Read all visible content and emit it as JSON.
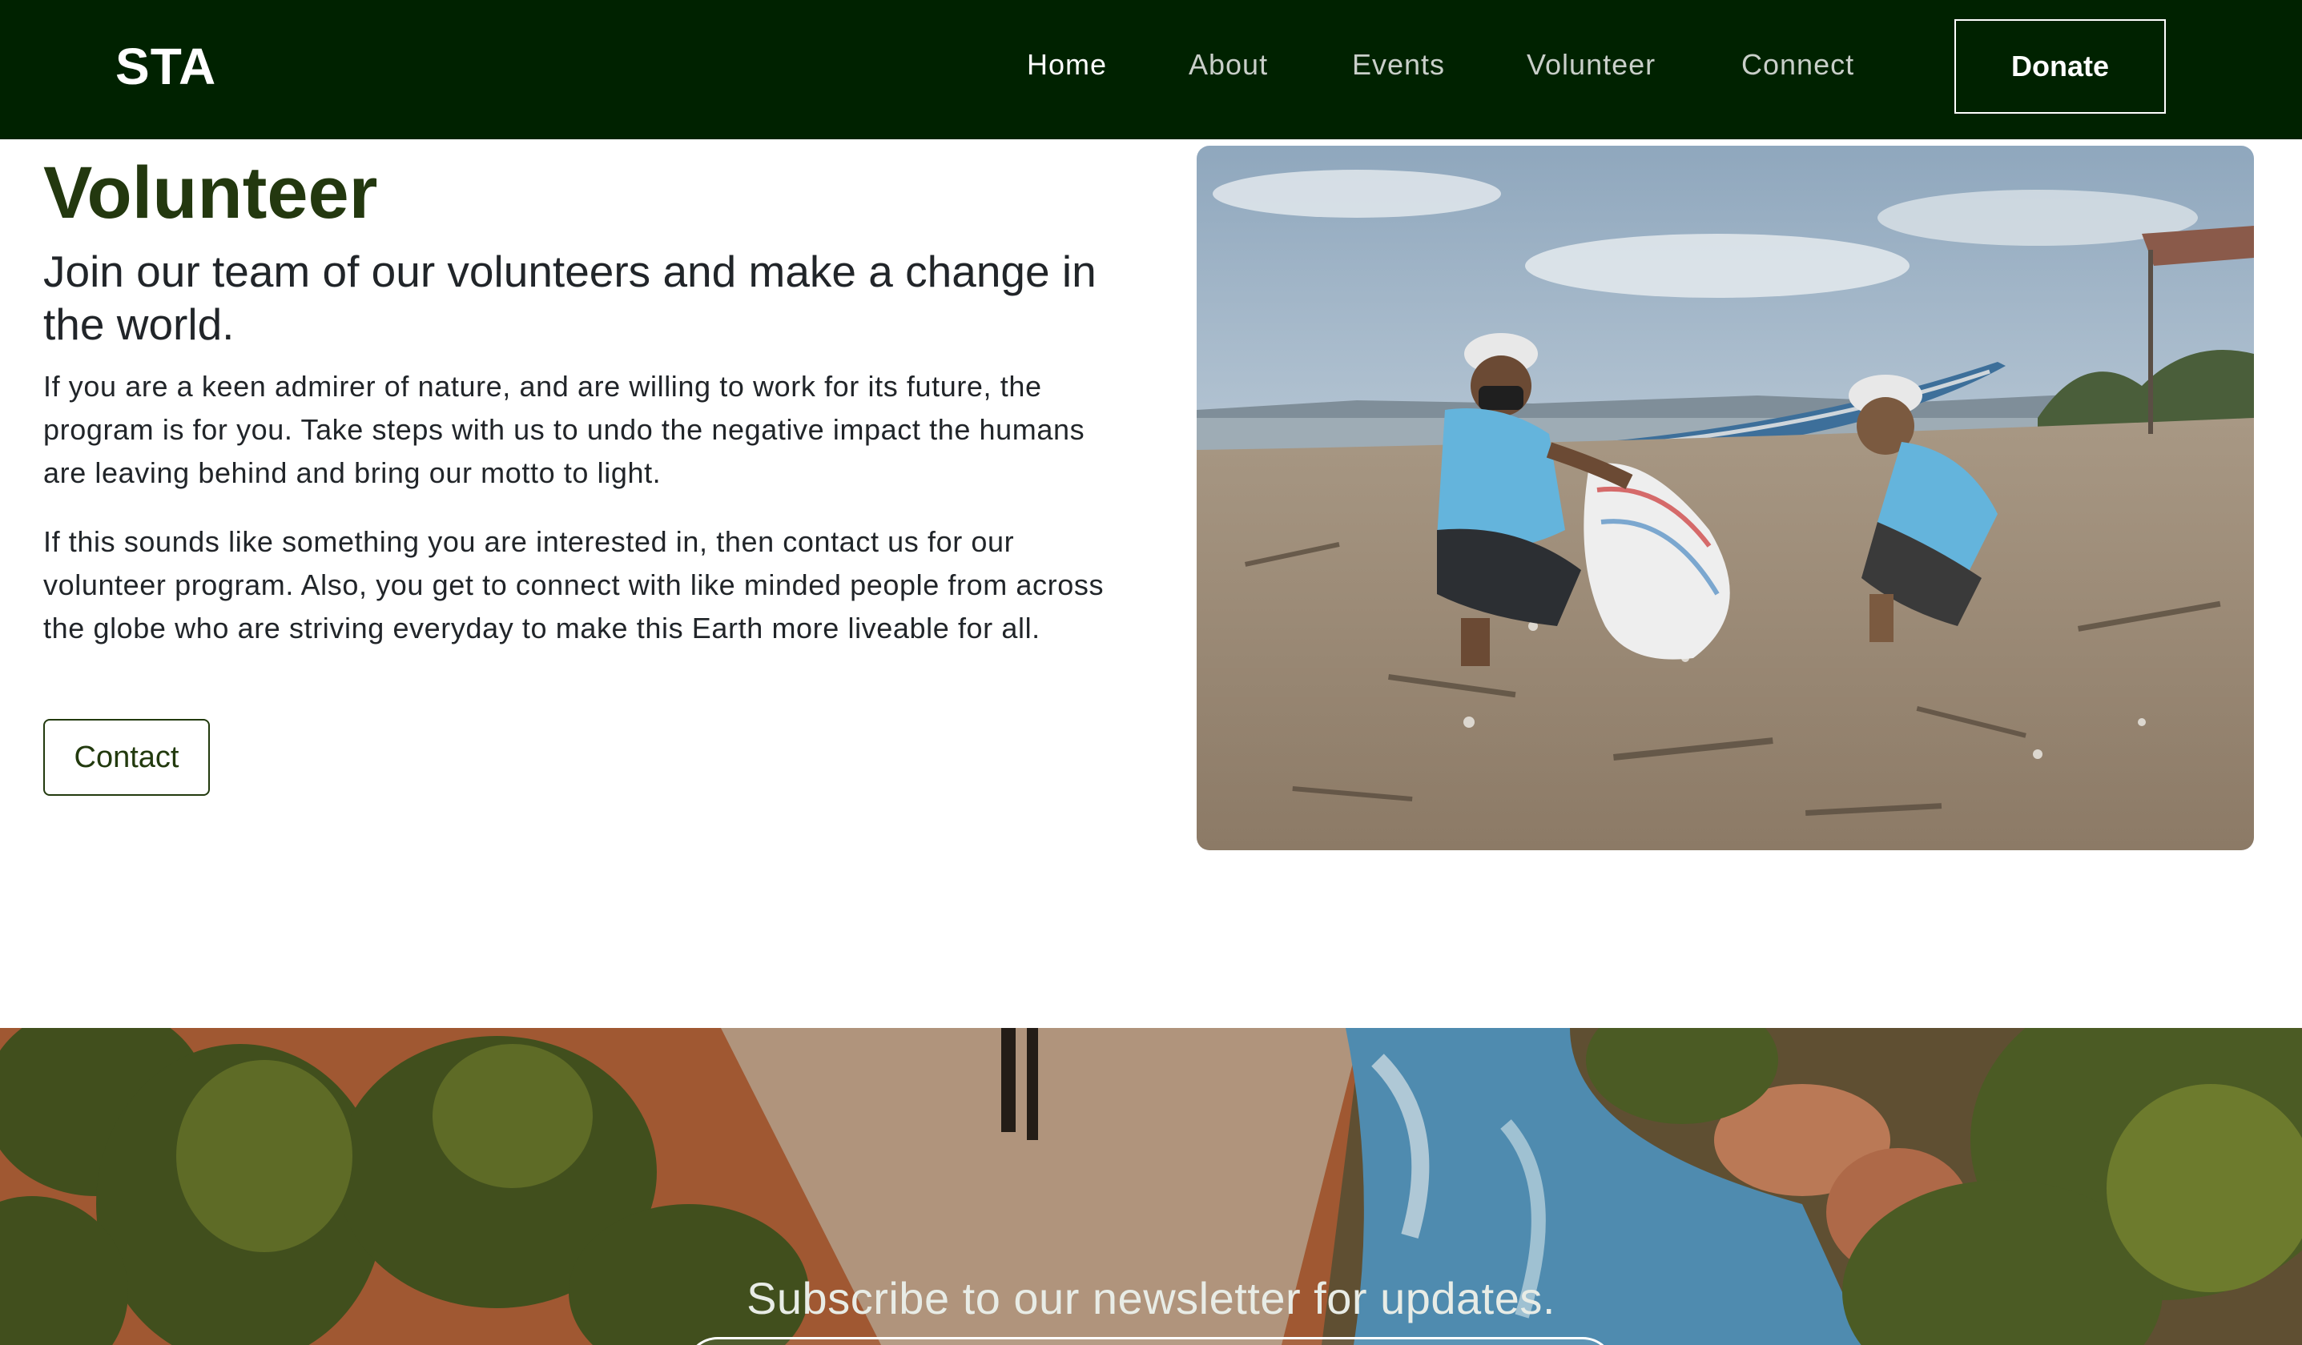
{
  "navbar": {
    "brand": "STA",
    "links": [
      {
        "label": "Home",
        "active": true
      },
      {
        "label": "About",
        "active": false
      },
      {
        "label": "Events",
        "active": false
      },
      {
        "label": "Volunteer",
        "active": false
      },
      {
        "label": "Connect",
        "active": false
      }
    ],
    "donate_label": "Donate",
    "background_color": "#002200"
  },
  "hero": {
    "title": "Volunteer",
    "subtitle": "Join our team of our volunteers and make a change in the world.",
    "paragraphs": [
      "If you are a keen admirer of nature, and are willing to work for its future, the program is for you. Take steps with us to undo the negative impact the humans are leaving behind and bring our motto to light.",
      "If this sounds like something you are interested in, then contact us for our volunteer program. Also, you get to connect with like minded people from across the globe who are striving everyday to make this Earth more liveable for all."
    ],
    "contact_label": "Contact",
    "title_color": "#23380f"
  },
  "newsletter": {
    "text": "Subscribe to our newsletter for updates."
  }
}
